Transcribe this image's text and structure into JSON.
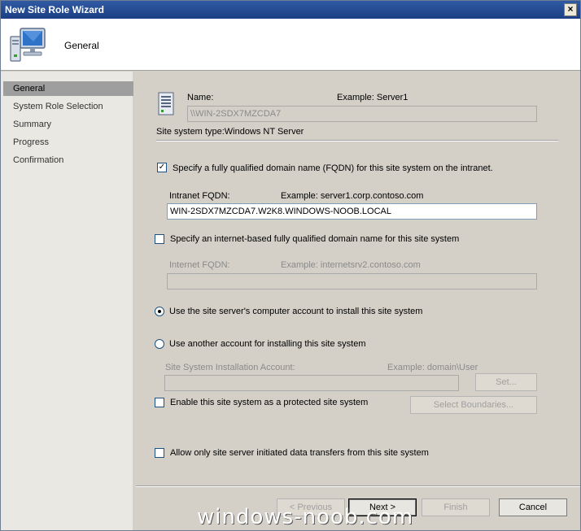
{
  "window": {
    "title": "New Site Role Wizard",
    "close_glyph": "×"
  },
  "header": {
    "title": "General",
    "icon": "computer-icon"
  },
  "sidebar": {
    "items": [
      {
        "label": "General",
        "active": true
      },
      {
        "label": "System Role Selection",
        "active": false
      },
      {
        "label": "Summary",
        "active": false
      },
      {
        "label": "Progress",
        "active": false
      },
      {
        "label": "Confirmation",
        "active": false
      }
    ]
  },
  "form": {
    "name_label": "Name:",
    "name_example": "Example: Server1",
    "name_value": "\\\\WIN-2SDX7MZCDA7",
    "site_system_type": "Site system type:Windows NT Server",
    "fqdn_checkbox": {
      "label": "Specify a fully qualified domain name (FQDN) for this site system on the intranet.",
      "checked": true
    },
    "intranet_fqdn_label": "Intranet FQDN:",
    "intranet_fqdn_example": "Example: server1.corp.contoso.com",
    "intranet_fqdn_value": "WIN-2SDX7MZCDA7.W2K8.WINDOWS-NOOB.LOCAL",
    "internet_checkbox": {
      "label": "Specify an internet-based fully qualified domain name for this site system",
      "checked": false
    },
    "internet_fqdn_label": "Internet FQDN:",
    "internet_fqdn_example": "Example: internetsrv2.contoso.com",
    "internet_fqdn_value": "",
    "radio_computer_account": {
      "label": "Use the site server's computer account to install this site system",
      "selected": true
    },
    "radio_another_account": {
      "label": "Use another account for installing this site system",
      "selected": false
    },
    "install_account_label": "Site System Installation Account:",
    "install_account_example": "Example: domain\\User",
    "install_account_value": "",
    "set_button": "Set...",
    "protected_checkbox": {
      "label": "Enable this site system as a protected site system",
      "checked": false
    },
    "select_boundaries_button": "Select Boundaries...",
    "transfers_checkbox": {
      "label": "Allow only site server initiated data transfers from this site system",
      "checked": false
    }
  },
  "buttons": {
    "previous": "< Previous",
    "next": "Next >",
    "finish": "Finish",
    "cancel": "Cancel"
  },
  "watermark": "windows-noob.com"
}
